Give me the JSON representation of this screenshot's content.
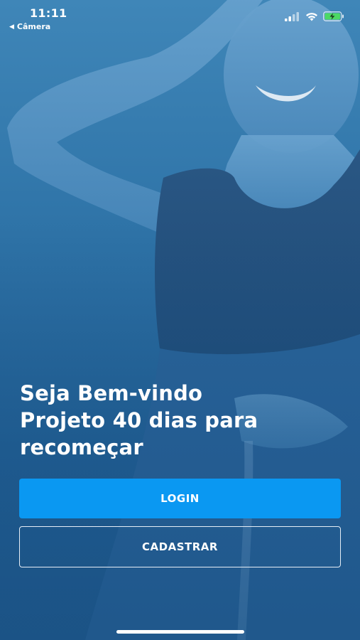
{
  "status_bar": {
    "time": "11:11",
    "back_label": "Câmera",
    "signal_icon": "signal-icon",
    "wifi_icon": "wifi-icon",
    "battery_icon": "battery-charging-icon"
  },
  "welcome": {
    "line1": "Seja Bem-vindo",
    "line2": "Projeto 40 dias para",
    "line3": "recomeçar"
  },
  "buttons": {
    "login": "LOGIN",
    "register": "CADASTRAR"
  },
  "colors": {
    "background": "#2a6ea3",
    "login_button": "#0a98f2",
    "text": "#ffffff"
  }
}
